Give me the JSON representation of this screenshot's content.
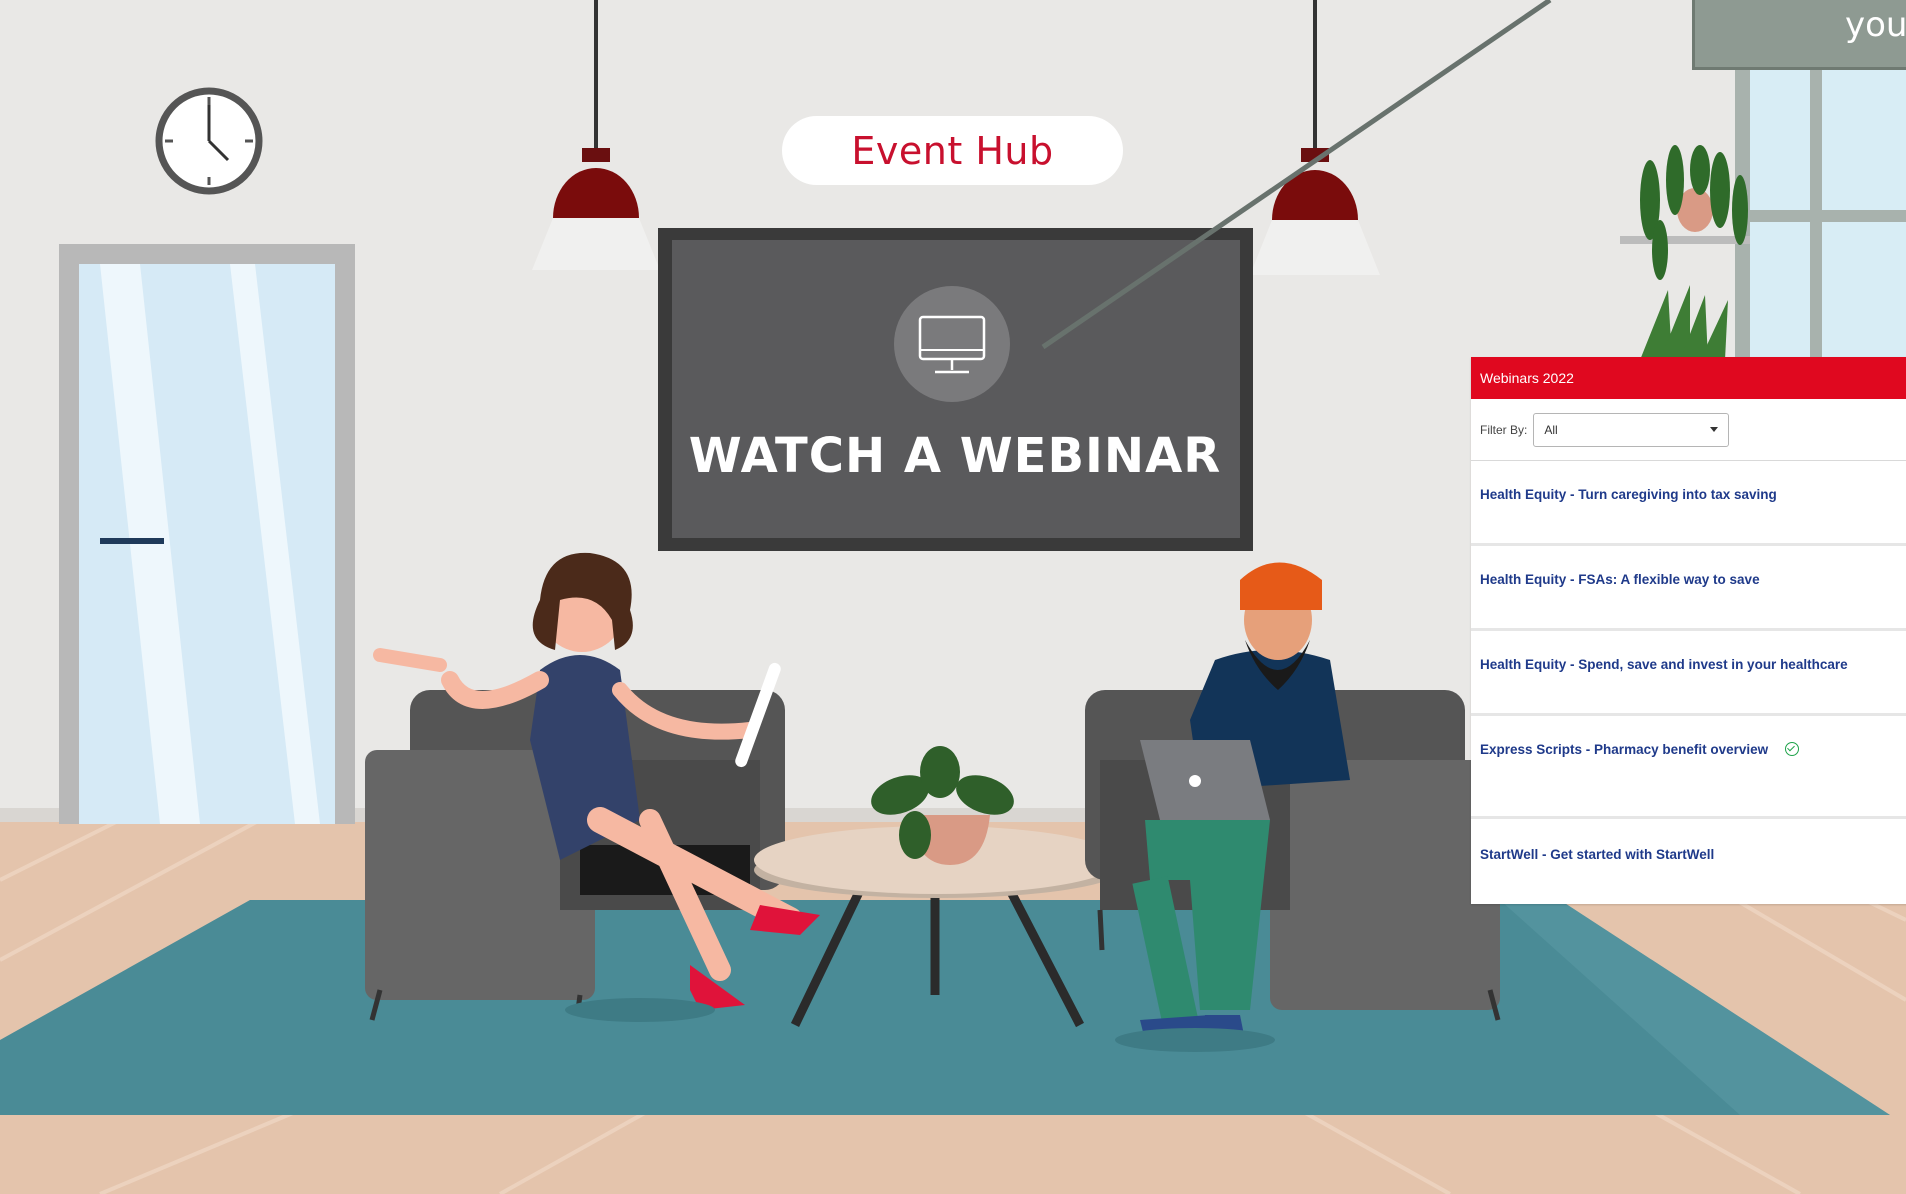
{
  "scene": {
    "hub_title": "Event Hub",
    "tv_title": "WATCH A WEBINAR",
    "callout_text": "your",
    "colors": {
      "brand_red": "#e0081f",
      "hub_red": "#c8102e",
      "link_blue": "#1f3a8a",
      "rug_teal": "#4a8b96"
    }
  },
  "panel": {
    "title": "Webinars 2022",
    "filter_label": "Filter By:",
    "filter_value": "All",
    "items": [
      {
        "label": "Health Equity - Turn caregiving into tax saving",
        "watched": false
      },
      {
        "label": "Health Equity - FSAs: A flexible way to save",
        "watched": false
      },
      {
        "label": "Health Equity - Spend, save and invest in your healthcare",
        "watched": false
      },
      {
        "label": "Express Scripts - Pharmacy benefit overview",
        "watched": true,
        "status_icon": "check-circle-icon"
      },
      {
        "label": "StartWell - Get started with StartWell",
        "watched": false
      }
    ]
  }
}
